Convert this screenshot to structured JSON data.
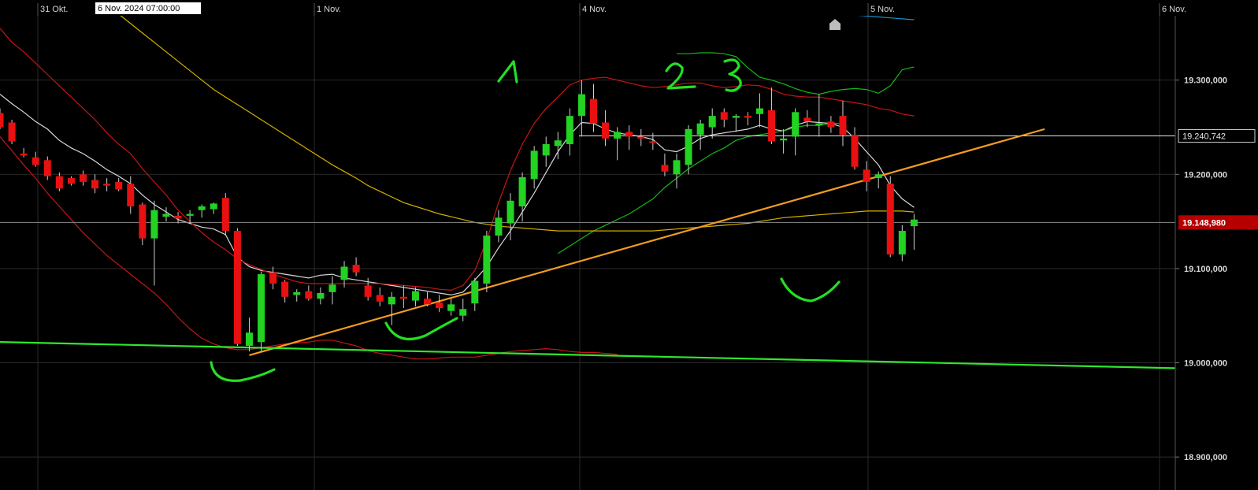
{
  "chart_data": {
    "type": "candlestick",
    "x_ticks": [
      "31 Okt.",
      "1 Nov.",
      "4 Nov.",
      "5 Nov.",
      "6 Nov."
    ],
    "crosshair_time_label": "6 Nov. 2024 07:00:00",
    "y_ticks": [
      {
        "label": "19.300,000",
        "value": 19300
      },
      {
        "label": "19.200,000",
        "value": 19200
      },
      {
        "label": "19.100,000",
        "value": 19100
      },
      {
        "label": "19.000,000",
        "value": 19000
      },
      {
        "label": "18.900,000",
        "value": 18900
      }
    ],
    "ylim": [
      18865,
      19385
    ],
    "grid": true,
    "price_level_label": "19.240,742",
    "price_level_value": 19240.742,
    "current_price_label": "19.148,980",
    "current_price_value": 19148.98,
    "candles": [
      [
        19265,
        19270,
        19248,
        19250
      ],
      [
        19255,
        19258,
        19232,
        19235
      ],
      [
        19222,
        19228,
        19218,
        19220
      ],
      [
        19218,
        19224,
        19208,
        19210
      ],
      [
        19215,
        19219,
        19194,
        19198
      ],
      [
        19198,
        19202,
        19182,
        19185
      ],
      [
        19196,
        19198,
        19188,
        19190
      ],
      [
        19200,
        19204,
        19188,
        19192
      ],
      [
        19194,
        19200,
        19180,
        19185
      ],
      [
        19190,
        19196,
        19182,
        19188
      ],
      [
        19192,
        19196,
        19182,
        19184
      ],
      [
        19190,
        19198,
        19158,
        19166
      ],
      [
        19168,
        19170,
        19125,
        19132
      ],
      [
        19132,
        19172,
        19082,
        19162
      ],
      [
        19155,
        19165,
        19150,
        19158
      ],
      [
        19156,
        19160,
        19148,
        19153
      ],
      [
        19156,
        19162,
        19148,
        19158
      ],
      [
        19162,
        19168,
        19154,
        19166
      ],
      [
        19163,
        19170,
        19158,
        19169
      ],
      [
        19175,
        19180,
        19136,
        19140
      ],
      [
        19140,
        19143,
        19018,
        19020
      ],
      [
        19018,
        19048,
        19012,
        19032
      ],
      [
        19022,
        19097,
        19012,
        19094
      ],
      [
        19096,
        19102,
        19078,
        19084
      ],
      [
        19086,
        19088,
        19064,
        19070
      ],
      [
        19072,
        19078,
        19065,
        19075
      ],
      [
        19076,
        19082,
        19066,
        19068
      ],
      [
        19068,
        19080,
        19062,
        19074
      ],
      [
        19075,
        19092,
        19062,
        19083
      ],
      [
        19088,
        19108,
        19080,
        19102
      ],
      [
        19104,
        19112,
        19092,
        19096
      ],
      [
        19082,
        19090,
        19066,
        19070
      ],
      [
        19072,
        19080,
        19060,
        19065
      ],
      [
        19062,
        19075,
        19040,
        19070
      ],
      [
        19070,
        19082,
        19058,
        19068
      ],
      [
        19066,
        19080,
        19060,
        19076
      ],
      [
        19068,
        19075,
        19060,
        19062
      ],
      [
        19064,
        19072,
        19054,
        19058
      ],
      [
        19055,
        19068,
        19050,
        19062
      ],
      [
        19050,
        19068,
        19044,
        19057
      ],
      [
        19063,
        19090,
        19055,
        19087
      ],
      [
        19084,
        19140,
        19075,
        19135
      ],
      [
        19135,
        19162,
        19128,
        19154
      ],
      [
        19148,
        19180,
        19130,
        19172
      ],
      [
        19166,
        19202,
        19150,
        19197
      ],
      [
        19195,
        19230,
        19185,
        19225
      ],
      [
        19220,
        19240,
        19208,
        19232
      ],
      [
        19230,
        19245,
        19216,
        19236
      ],
      [
        19232,
        19270,
        19220,
        19262
      ],
      [
        19262,
        19300,
        19240,
        19285
      ],
      [
        19280,
        19296,
        19245,
        19254
      ],
      [
        19255,
        19268,
        19230,
        19238
      ],
      [
        19238,
        19250,
        19215,
        19245
      ],
      [
        19245,
        19252,
        19226,
        19240
      ],
      [
        19240,
        19248,
        19230,
        19238
      ],
      [
        19235,
        19244,
        19226,
        19234
      ],
      [
        19210,
        19222,
        19198,
        19203
      ],
      [
        19200,
        19222,
        19185,
        19215
      ],
      [
        19210,
        19252,
        19200,
        19248
      ],
      [
        19242,
        19258,
        19226,
        19254
      ],
      [
        19250,
        19270,
        19238,
        19262
      ],
      [
        19266,
        19270,
        19250,
        19258
      ],
      [
        19260,
        19264,
        19245,
        19262
      ],
      [
        19262,
        19266,
        19252,
        19260
      ],
      [
        19264,
        19286,
        19250,
        19270
      ],
      [
        19268,
        19292,
        19232,
        19235
      ],
      [
        19236,
        19248,
        19222,
        19238
      ],
      [
        19240,
        19270,
        19220,
        19266
      ],
      [
        19260,
        19268,
        19250,
        19256
      ],
      [
        19252,
        19285,
        19240,
        19254
      ],
      [
        19256,
        19262,
        19244,
        19250
      ],
      [
        19262,
        19278,
        19230,
        19242
      ],
      [
        19242,
        19250,
        19205,
        19208
      ],
      [
        19205,
        19214,
        19182,
        19192
      ],
      [
        19196,
        19203,
        19185,
        19200
      ],
      [
        19190,
        19198,
        19112,
        19115
      ],
      [
        19115,
        19146,
        19108,
        19140
      ],
      [
        19145,
        19158,
        19120,
        19152
      ]
    ],
    "series": [
      {
        "kind": "bollinger-upper-short",
        "color": "#16b816",
        "values": [
          null,
          null,
          null,
          null,
          null,
          null,
          null,
          null,
          null,
          null,
          null,
          null,
          null,
          null,
          null,
          null,
          null,
          null,
          null,
          null,
          null,
          null,
          null,
          null,
          null,
          null,
          null,
          null,
          null,
          null,
          null,
          null,
          null,
          null,
          null,
          null,
          null,
          null,
          null,
          null,
          null,
          null,
          null,
          null,
          null,
          null,
          null,
          null,
          null,
          null,
          null,
          null,
          null,
          null,
          null,
          null,
          null,
          19328,
          19328,
          19329,
          19329,
          19328,
          19325,
          19313,
          19303,
          19300,
          19296,
          19291,
          19287,
          19285,
          19288,
          19290,
          19291,
          19290,
          19286,
          19294,
          19311,
          19314
        ]
      },
      {
        "kind": "bollinger-middle-short",
        "color": "#d9d9d9",
        "values": [
          19285,
          19275,
          19266,
          19256,
          19248,
          19236,
          19228,
          19222,
          19214,
          19205,
          19198,
          19190,
          19178,
          19168,
          19160,
          19152,
          19148,
          19144,
          19142,
          19136,
          19112,
          19102,
          19098,
          19096,
          19094,
          19092,
          19090,
          19093,
          19094,
          19090,
          19088,
          19086,
          19084,
          19082,
          19080,
          19078,
          19076,
          19074,
          19072,
          19075,
          19088,
          19102,
          19122,
          19140,
          19160,
          19180,
          19202,
          19224,
          19242,
          19255,
          19254,
          19248,
          19244,
          19242,
          19240,
          19237,
          19226,
          19224,
          19230,
          19238,
          19242,
          19244,
          19246,
          19248,
          19252,
          19248,
          19246,
          19252,
          19256,
          19255,
          19254,
          19250,
          19238,
          19224,
          19210,
          19188,
          19174,
          19165
        ]
      },
      {
        "kind": "bollinger-lower-short",
        "color": "#16b816",
        "values": [
          null,
          null,
          null,
          null,
          null,
          null,
          null,
          null,
          null,
          null,
          null,
          null,
          null,
          null,
          null,
          null,
          null,
          null,
          null,
          null,
          null,
          null,
          null,
          null,
          null,
          null,
          null,
          null,
          null,
          null,
          null,
          null,
          null,
          null,
          null,
          null,
          null,
          null,
          null,
          null,
          null,
          null,
          null,
          null,
          null,
          null,
          null,
          19116,
          19124,
          19132,
          19140,
          19146,
          19152,
          19158,
          19166,
          19174,
          19186,
          19196,
          19206,
          19214,
          19222,
          19228,
          19236,
          19240,
          19242,
          19244,
          19246,
          19250,
          19252,
          19252,
          19254,
          19254,
          null,
          null,
          null,
          null,
          null,
          null
        ]
      },
      {
        "kind": "bollinger-upper-long",
        "color": "#c81414",
        "values": [
          19355,
          19340,
          19330,
          19318,
          19306,
          19294,
          19282,
          19270,
          19258,
          19244,
          19232,
          19222,
          19206,
          19192,
          19178,
          19162,
          19150,
          19138,
          19128,
          19120,
          19110,
          19104,
          19099,
          19094,
          19090,
          19086,
          19084,
          19084,
          19084,
          19084,
          19084,
          19084,
          19084,
          19083,
          19082,
          19081,
          19080,
          19078,
          19077,
          19082,
          19098,
          19130,
          19170,
          19204,
          19232,
          19254,
          19270,
          19282,
          19295,
          19300,
          19302,
          19303,
          19300,
          19297,
          19294,
          19292,
          19293,
          19295,
          19297,
          19297,
          19294,
          19292,
          19293,
          19295,
          19294,
          19290,
          19285,
          19283,
          19282,
          19282,
          19280,
          19278,
          19276,
          19274,
          19270,
          19268,
          19264,
          19262
        ]
      },
      {
        "kind": "bollinger-lower-long",
        "color": "#c81414",
        "values": [
          19240,
          19225,
          19210,
          19196,
          19180,
          19166,
          19152,
          19138,
          19126,
          19114,
          19104,
          19094,
          19084,
          19074,
          19062,
          19048,
          19036,
          19026,
          19020,
          19016,
          19014,
          19014,
          19016,
          19018,
          19020,
          19021,
          19022,
          19024,
          19024,
          19021,
          19018,
          19013,
          19010,
          19008,
          19006,
          19004,
          19004,
          19005,
          19006,
          19006,
          19006,
          19008,
          19010,
          19012,
          19013,
          19014,
          19015,
          19014,
          19012,
          19011,
          19011,
          19010,
          19009,
          null,
          null,
          null,
          null,
          null,
          null,
          null,
          null,
          null,
          null,
          null,
          null,
          null,
          null,
          null,
          null,
          null,
          null,
          null,
          null,
          null,
          null,
          null,
          null,
          null
        ]
      },
      {
        "kind": "moving-average-long",
        "color": "#d4b000",
        "values": [
          null,
          null,
          null,
          null,
          null,
          null,
          null,
          null,
          null,
          19378,
          19370,
          19360,
          19350,
          19340,
          19330,
          19320,
          19310,
          19300,
          19290,
          19282,
          19274,
          19266,
          19258,
          19250,
          19242,
          19234,
          19226,
          19218,
          19210,
          19203,
          19196,
          19188,
          19182,
          19176,
          19170,
          19166,
          19162,
          19158,
          19155,
          19152,
          19149,
          19147,
          19145,
          19144,
          19143,
          19142,
          19141,
          19140,
          19140,
          19140,
          19140,
          19140,
          19140,
          19140,
          19140,
          19140,
          19141,
          19142,
          19143,
          19144,
          19145,
          19146,
          19147,
          19148,
          19150,
          19152,
          19154,
          19155,
          19156,
          19157,
          19158,
          19159,
          19160,
          19161,
          19161,
          19161,
          19161,
          19160
        ]
      },
      {
        "kind": "moving-average-very-long",
        "color": "#1a8fc9",
        "values": [
          null,
          null,
          null,
          null,
          null,
          null,
          null,
          null,
          null,
          null,
          null,
          null,
          null,
          null,
          null,
          null,
          null,
          null,
          null,
          null,
          null,
          null,
          null,
          null,
          null,
          null,
          null,
          null,
          null,
          null,
          null,
          null,
          null,
          null,
          null,
          null,
          null,
          null,
          null,
          null,
          null,
          null,
          null,
          null,
          null,
          null,
          null,
          null,
          null,
          null,
          null,
          null,
          null,
          19385,
          19384,
          19383,
          19382,
          19381,
          19380,
          19380,
          19379,
          19378,
          19377,
          19376,
          19375,
          19375,
          19374,
          19373,
          19372,
          19371,
          19370,
          19370,
          19369,
          19368,
          19367,
          19366,
          19365,
          19364
        ]
      }
    ],
    "trendlines": [
      {
        "kind": "support-rising",
        "color": "#f39c1f",
        "from": [
          21,
          19008
        ],
        "to": [
          88,
          19248
        ]
      },
      {
        "kind": "support-flat",
        "color": "#2ee82e",
        "from": [
          -14,
          19026
        ],
        "to": [
          100,
          18994
        ]
      }
    ],
    "annotations": [
      "1",
      "2",
      "3"
    ]
  }
}
